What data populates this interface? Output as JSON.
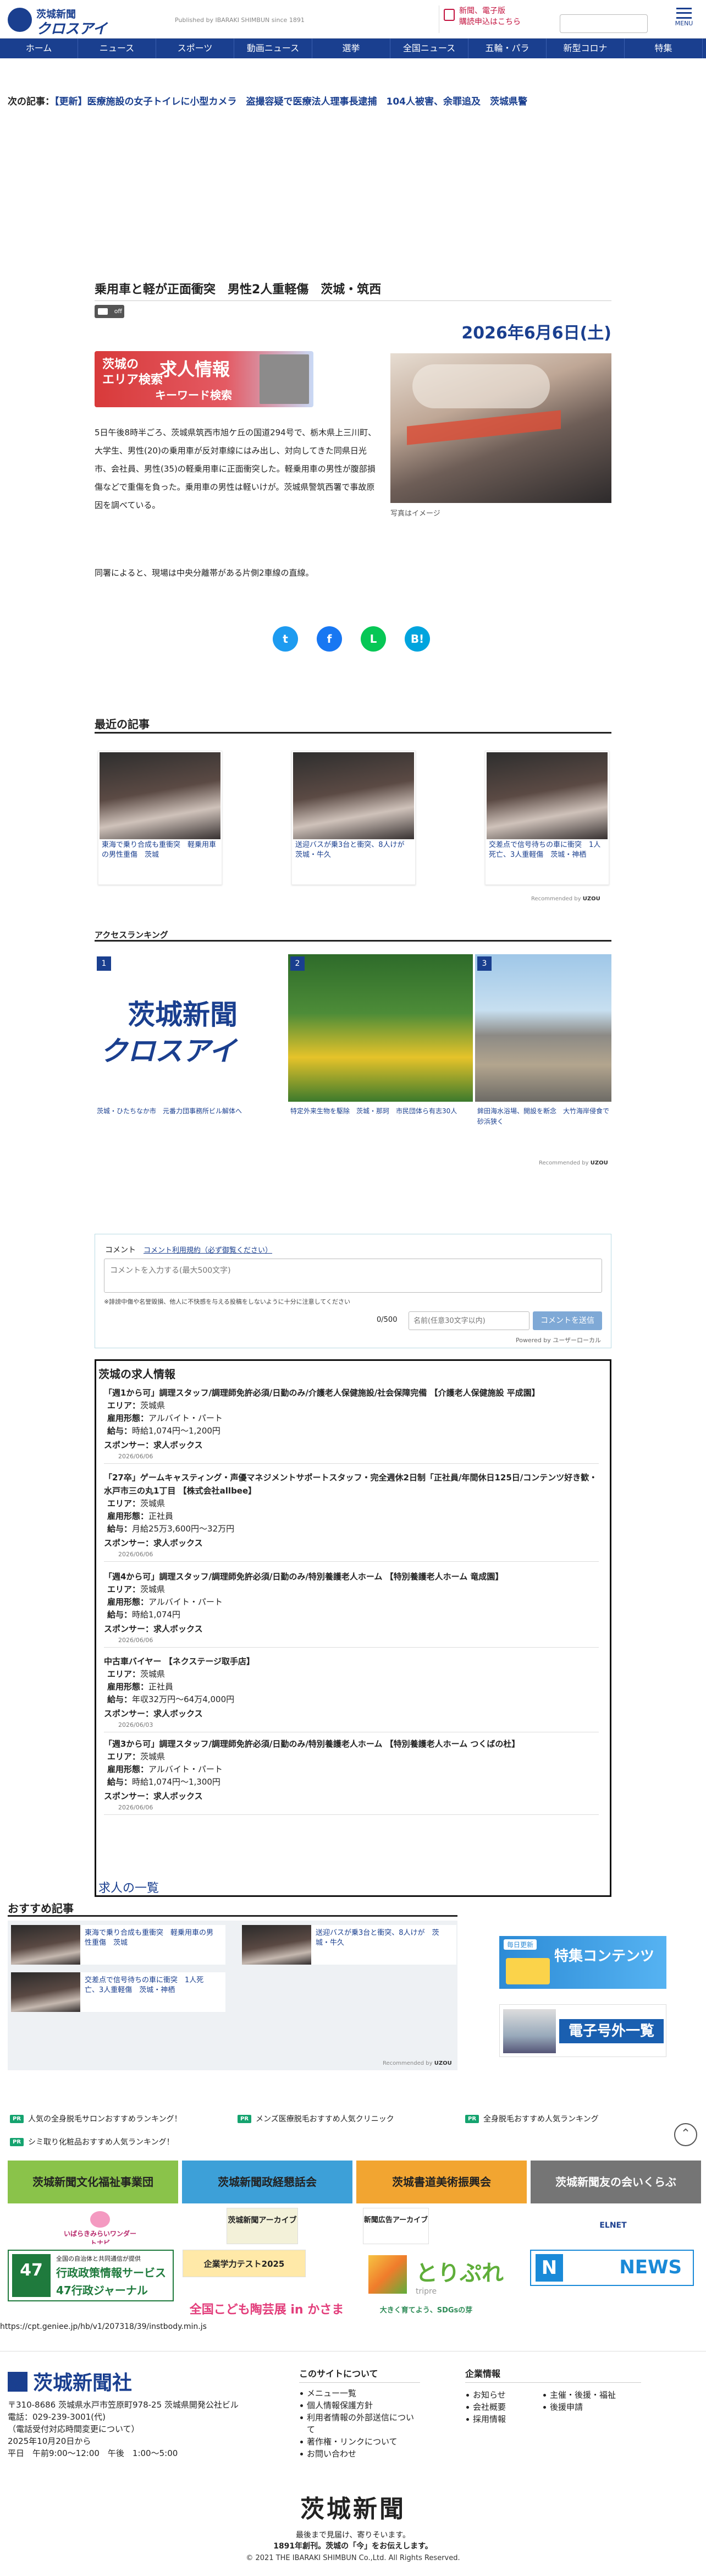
{
  "header": {
    "logo_top": "茨城新聞",
    "logo_bottom": "クロスアイ",
    "published": "Published by IBARAKI SHIMBUN since 1891",
    "subscribe": [
      "新聞、電子版",
      "購読申込はこちら"
    ],
    "menu_label": "MENU"
  },
  "nav": [
    {
      "label": "ホーム",
      "w": 110
    },
    {
      "label": "ニュース",
      "w": 116
    },
    {
      "label": "スポーツ",
      "w": 110
    },
    {
      "label": "動画ニュース",
      "w": 124
    },
    {
      "label": "選挙",
      "w": 110
    },
    {
      "label": "全国ニュース",
      "w": 114
    },
    {
      "label": "五輪・パラ",
      "w": 112
    },
    {
      "label": "新型コロナ",
      "w": 124
    },
    {
      "label": "特集",
      "w": 110
    }
  ],
  "next_article": {
    "label": "次の記事：",
    "text": "【更新】医療施設の女子トイレに小型カメラ　盗撮容疑で医療法人理事長逮捕　104人被害、余罪追及　茨城県警"
  },
  "article": {
    "title": "乗用車と軽が正面衝突　男性2人重軽傷　茨城・筑西",
    "speaker_label": "off",
    "date": "2026年6月6日(土)",
    "ad": {
      "a1": "茨城の",
      "a2": "エリア検索",
      "b": "求人情報",
      "c": "キーワード検索"
    },
    "photo_caption": "写真はイメージ",
    "body1": "5日午後8時半ごろ、茨城県筑西市旭ケ丘の国道294号で、栃木県上三川町、大学生、男性(20)の乗用車が反対車線にはみ出し、対向してきた同県日光市、会社員、男性(35)の軽乗用車に正面衝突した。軽乗用車の男性が腹部損傷などで重傷を負った。乗用車の男性は軽いけが。茨城県警筑西署で事故原因を調べている。",
    "body2": "同署によると、現場は中央分離帯がある片側2車線の直線。"
  },
  "share": [
    {
      "name": "twitter",
      "glyph": "t",
      "color": "#1d9bf0"
    },
    {
      "name": "facebook",
      "glyph": "f",
      "color": "#1877f2"
    },
    {
      "name": "line",
      "glyph": "L",
      "color": "#06c755"
    },
    {
      "name": "hatena",
      "glyph": "B!",
      "color": "#00a4de"
    }
  ],
  "recent": {
    "title": "最近の記事",
    "items": [
      "東海で乗り合成も重衝突　軽乗用車の男性重傷　茨城",
      "送迎バスが乗3台と衝突、8人けが　茨城・牛久",
      "交差点で信号待ちの車に衝突　1人死亡、3人重軽傷　茨城・神栖"
    ],
    "recommended": "Recommended by"
  },
  "ranking": {
    "title": "アクセスランキング",
    "items": [
      {
        "num": "1",
        "caption": "茨城・ひたちなか市　元番力団事務所ビル解体へ"
      },
      {
        "num": "2",
        "caption": "特定外来生物を駆除　茨城・那珂　市民団体ら有志30人"
      },
      {
        "num": "3",
        "caption": "鉾田海水浴場、開設を断念　大竹海岸侵食で砂浜狭く"
      }
    ],
    "logo_top": "茨城新聞",
    "logo_bottom": "クロスアイ",
    "recommended": "Recommended by"
  },
  "comment": {
    "label": "コメント",
    "link": "コメント利用規約（必ず御覧ください）",
    "placeholder": "コメントを入力する(最大500文字)",
    "note": "※誹謗中傷や名誉毀損、他人に不快感を与える投稿をしないように十分に注意してください",
    "count": "0/500",
    "name_placeholder": "名前(任意30文字以内)",
    "submit": "コメントを送信",
    "powered": "Powered by ユーザーローカル"
  },
  "jobs": {
    "title": "茨城の求人情報",
    "area_label": "エリア：",
    "type_label": "雇用形態：",
    "pay_label": "給与：",
    "sponsor_label": "スポンサー：",
    "items": [
      {
        "title": "「週1から可」調理スタッフ/調理師免許必須/日勤のみ/介護老人保健施設/社会保障完備 【介護老人保健施設 平成園】",
        "area": "茨城県",
        "type": "アルバイト・パート",
        "pay": "時給1,074円〜1,200円",
        "sponsor": "求人ボックス",
        "date": "2026/06/06"
      },
      {
        "title": "「27卒」ゲームキャスティング・声優マネジメントサポートスタッフ・完全週休2日制「正社員/年間休日125日/コンテンツ好き歓・水戸市三の丸1丁目 【株式会社allbee】",
        "area": "茨城県",
        "type": "正社員",
        "pay": "月給25万3,600円〜32万円",
        "sponsor": "求人ボックス",
        "date": "2026/06/06"
      },
      {
        "title": "「週4から可」調理スタッフ/調理師免許必須/日勤のみ/特別養護老人ホーム 【特別養護老人ホーム 竜成園】",
        "area": "茨城県",
        "type": "アルバイト・パート",
        "pay": "時給1,074円",
        "sponsor": "求人ボックス",
        "date": "2026/06/06"
      },
      {
        "title": "中古車バイヤー 【ネクステージ取手店】",
        "area": "茨城県",
        "type": "正社員",
        "pay": "年収32万円〜64万4,000円",
        "sponsor": "求人ボックス",
        "date": "2026/06/03"
      },
      {
        "title": "「週3から可」調理スタッフ/調理師免許必須/日勤のみ/特別養護老人ホーム 【特別養護老人ホーム つくばの杜】",
        "area": "茨城県",
        "type": "アルバイト・パート",
        "pay": "時給1,074円〜1,300円",
        "sponsor": "求人ボックス",
        "date": "2026/06/06"
      }
    ],
    "all": "求人の一覧"
  },
  "osusume": {
    "title": "おすすめ記事",
    "items": [
      "東海で乗り合成も重衝突　軽乗用車の男性重傷　茨城",
      "送迎バスが乗3台と衝突、8人けが　茨城・牛久",
      "交差点で信号待ちの車に衝突　1人死亡、3人重軽傷　茨城・神栖"
    ],
    "recommended": "Recommended by",
    "ad1": "特集コンテンツ",
    "ad1_sub": "毎日更新",
    "ad2": "電子号外一覧"
  },
  "pr": [
    "人気の全身脱毛サロンおすすめランキング！",
    "メンズ医療脱毛おすすめ人気クリニック",
    "全身脱毛おすすめ人気ランキング",
    "シミ取り化粧品おすすめ人気ランキング！"
  ],
  "pr_tag": "PR",
  "groups": [
    {
      "label": "茨城新聞文化福祉事業団",
      "color": "#8ac34a"
    },
    {
      "label": "茨城新聞政経懇話会",
      "color": "#3da0d8"
    },
    {
      "label": "茨城書道美術振興会",
      "color": "#f2a531"
    },
    {
      "label": "茨城新聞友の会いくらぶ",
      "color": "#757575"
    }
  ],
  "banners": {
    "b1": "いばらきみらいワンダートナビ",
    "b2": "茨城新聞アーカイブ",
    "b3": "新聞広告アーカイブ",
    "b4": "ELNET",
    "b5_a": "全国の自治体と共同通信が提供",
    "b5_b": "行政政策情報サービス",
    "b5_c": "47行政ジャーナル",
    "b6": "企業学力テスト2025",
    "b7": "とりぷれ",
    "b7_sub": "tripre",
    "b8": "NEWS",
    "b9": "全国こども陶芸展 in かさま",
    "b10": "大きく育てよう、SDGsの芽"
  },
  "url": "https://cpt.geniee.jp/hb/v1/207318/39/instbody.min.js",
  "footer": {
    "logo": "茨城新聞社",
    "address": [
      "〒310-8686 茨城県水戸市笠原町978-25 茨城県開発公社ビル",
      "電話：029-239-3001(代)",
      "（電話受付対応時間変更について）",
      "2025年10月20日から",
      "平日　午前9:00〜12:00　午後　1:00〜5:00"
    ],
    "col1_title": "このサイトについて",
    "col1": [
      "メニュー一覧",
      "個人情報保護方針",
      "利用者情報の外部送信について",
      "著作権・リンクについて",
      "お問い合わせ"
    ],
    "col2_title": "企業情報",
    "col2a": [
      "お知らせ",
      "会社概要",
      "採用情報"
    ],
    "col2b": [
      "主催・後援・福祉",
      "後援申請"
    ],
    "brand": "茨城新聞",
    "slogan1": "最後まで見届け、寄りそいます。",
    "slogan2": "1891年創刊。茨城の「今」をお伝えします。",
    "copyright": "© 2021 THE IBARAKI SHIMBUN Co.,Ltd. All Rights Reserved."
  }
}
